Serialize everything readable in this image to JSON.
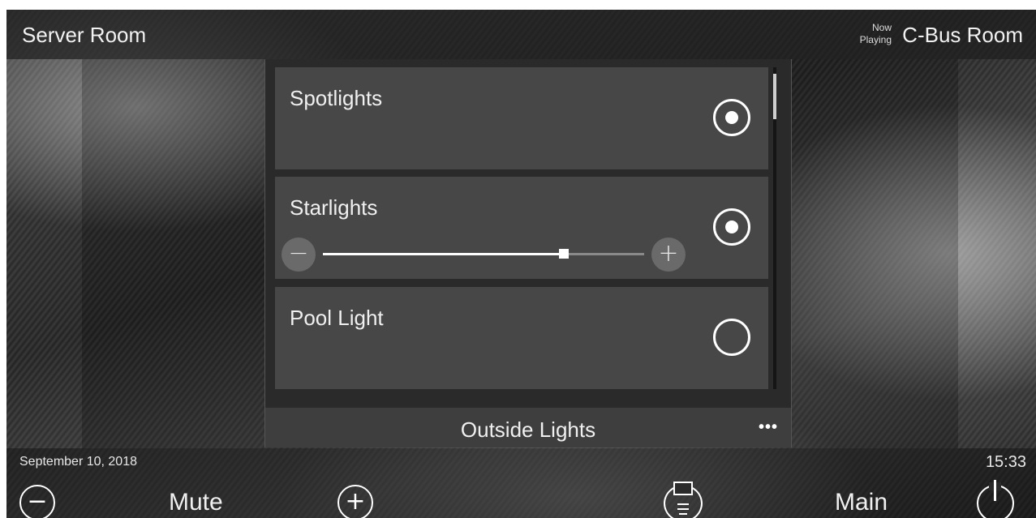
{
  "header": {
    "room_name": "Server Room",
    "now_playing_line1": "Now",
    "now_playing_line2": "Playing",
    "source_name": "C-Bus Room"
  },
  "lighting_panel": {
    "title": "Outside Lights",
    "more_label": "•••",
    "items": [
      {
        "label": "Spotlights",
        "state": "on"
      },
      {
        "label": "Starlights",
        "state": "on",
        "dimmer_level": 0.75,
        "minus_label": "−",
        "plus_label": "+"
      },
      {
        "label": "Pool Light",
        "state": "off"
      }
    ]
  },
  "footer": {
    "date": "September 10, 2018",
    "time": "15:33",
    "volume_down_label": "−",
    "mute_label": "Mute",
    "volume_up_label": "+",
    "main_label": "Main"
  }
}
